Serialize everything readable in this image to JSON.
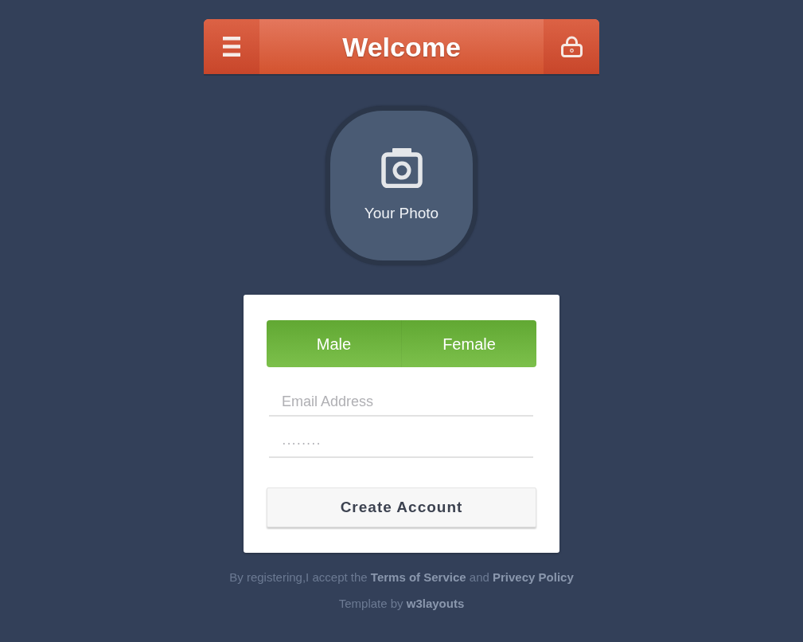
{
  "header": {
    "title": "Welcome"
  },
  "photo": {
    "label": "Your Photo"
  },
  "form": {
    "gender_options": [
      {
        "label": "Male"
      },
      {
        "label": "Female"
      }
    ],
    "fields": [
      {
        "kind": "email",
        "placeholder": "Email Address"
      },
      {
        "kind": "password",
        "placeholder": "········"
      }
    ],
    "submit": {
      "label": "Create Account"
    }
  },
  "footer": {
    "terms": [
      {
        "kind": "text",
        "text": "By registering,I accept the"
      },
      {
        "kind": "link",
        "text": "Terms of Service"
      },
      {
        "kind": "text",
        "text": "and"
      },
      {
        "kind": "link",
        "text": "Privecy Policy"
      }
    ],
    "credit": [
      {
        "kind": "text",
        "text": "Template by"
      },
      {
        "kind": "link",
        "text": "w3layouts"
      }
    ]
  }
}
